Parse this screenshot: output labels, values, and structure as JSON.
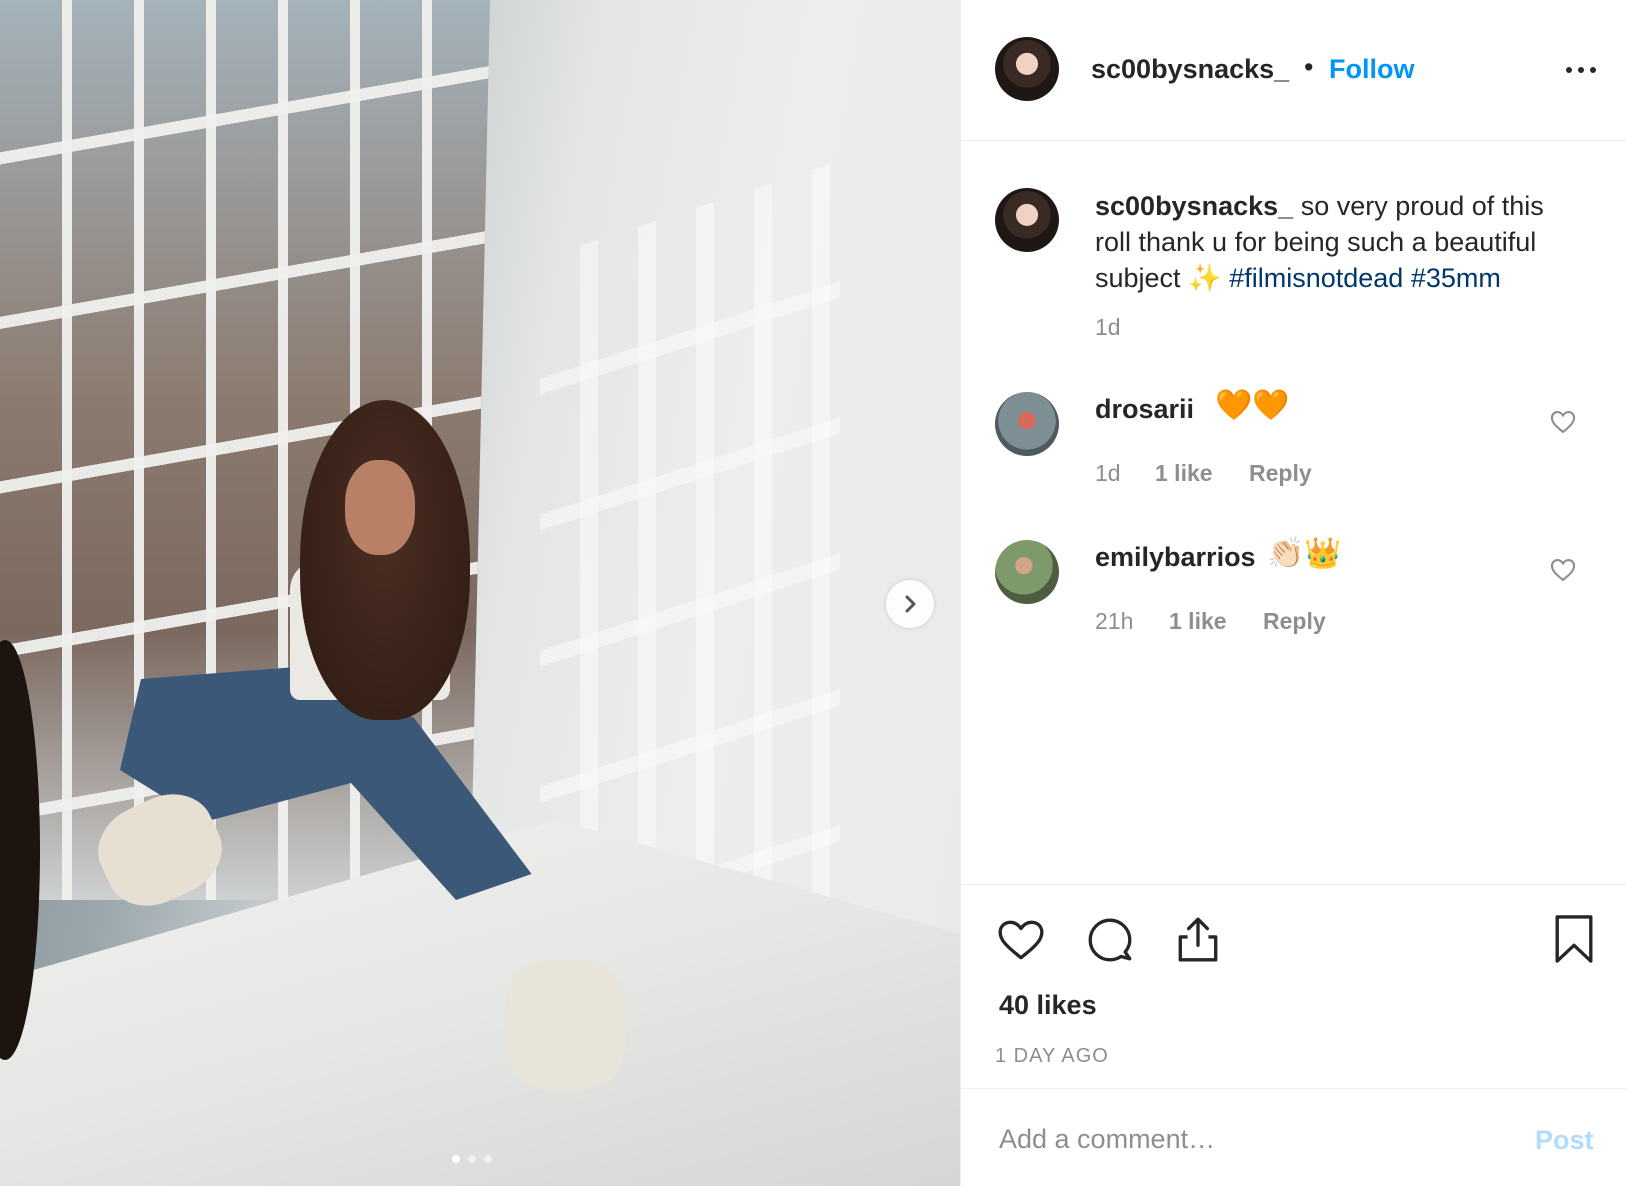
{
  "post": {
    "username": "sc00bysnacks_",
    "bullet": "•",
    "follow_label": "Follow",
    "more_icon": "more-options-icon",
    "caption_text": "so very proud of this roll thank u for being such a beautiful subject",
    "caption_emoji": "✨",
    "hashtags": [
      "#filmisnotdead",
      "#35mm"
    ],
    "caption_time": "1d",
    "likes": "40 likes",
    "time_ago": "1 DAY AGO",
    "carousel": {
      "dots": 3,
      "active_index": 0
    }
  },
  "comments": [
    {
      "username": "drosarii",
      "text": "🧡🧡",
      "time": "1d",
      "likes": "1 like",
      "reply": "Reply"
    },
    {
      "username": "emilybarrios",
      "text": "👏🏻👑",
      "time": "21h",
      "likes": "1 like",
      "reply": "Reply"
    }
  ],
  "comment_box": {
    "placeholder": "Add a comment…",
    "post_label": "Post"
  },
  "colors": {
    "follow": "#0095f6",
    "hashtag": "#00376b",
    "post_disabled": "#b3dbff",
    "muted": "#8e8e8e"
  }
}
